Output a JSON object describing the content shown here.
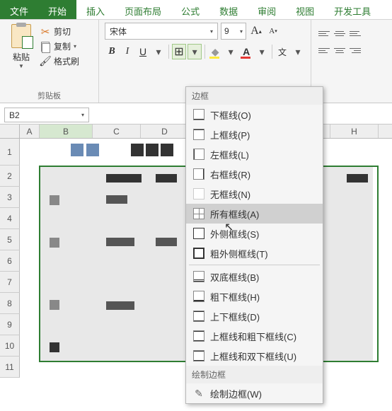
{
  "menu": {
    "file": "文件",
    "home": "开始",
    "insert": "插入",
    "layout": "页面布局",
    "formula": "公式",
    "data": "数据",
    "review": "审阅",
    "view": "视图",
    "dev": "开发工具"
  },
  "ribbon": {
    "paste": "粘贴",
    "cut": "剪切",
    "copy": "复制",
    "format_painter": "格式刷",
    "clipboard_label": "剪贴板",
    "font_name": "宋体",
    "font_size": "9"
  },
  "namebox": "B2",
  "columns": [
    "A",
    "B",
    "C",
    "D",
    "",
    "H"
  ],
  "rows": [
    "1",
    "2",
    "3",
    "4",
    "5",
    "6",
    "7",
    "8",
    "9",
    "10",
    "11"
  ],
  "dropdown": {
    "section_border": "边框",
    "bottom": "下框线(O)",
    "top": "上框线(P)",
    "left": "左框线(L)",
    "right": "右框线(R)",
    "none": "无框线(N)",
    "all": "所有框线(A)",
    "outside": "外侧框线(S)",
    "thick_outside": "粗外侧框线(T)",
    "double_bottom": "双底框线(B)",
    "thick_bottom": "粗下框线(H)",
    "top_bottom": "上下框线(D)",
    "top_thick_bottom": "上框线和粗下框线(C)",
    "top_double_bottom": "上框线和双下框线(U)",
    "section_draw": "绘制边框",
    "draw_border": "绘制边框(W)"
  }
}
